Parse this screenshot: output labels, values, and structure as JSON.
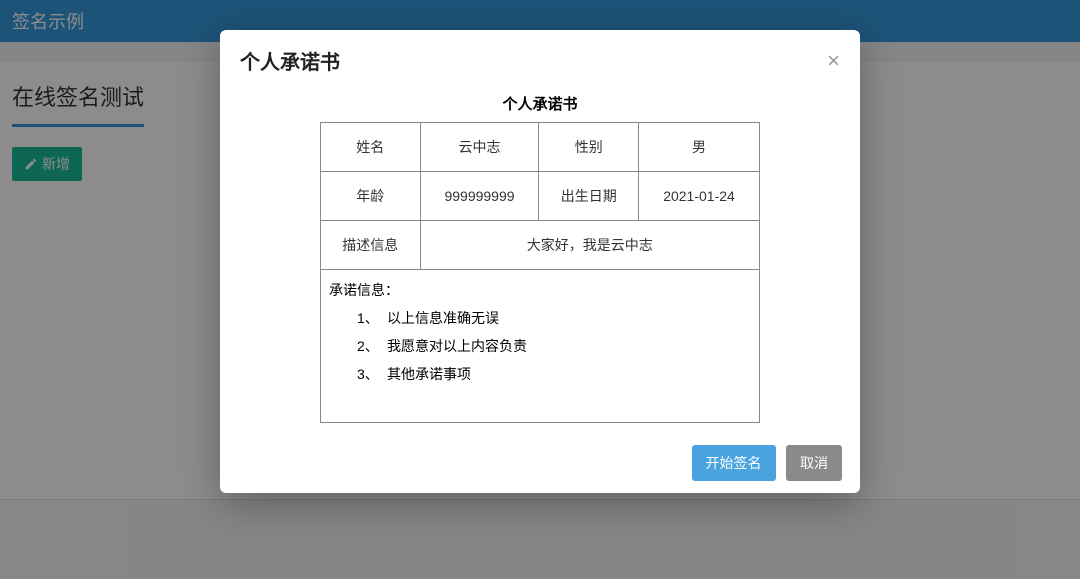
{
  "header": {
    "title": "签名示例"
  },
  "page": {
    "section_title": "在线签名测试",
    "add_button_label": "新增"
  },
  "modal": {
    "title": "个人承诺书",
    "close_glyph": "×",
    "document": {
      "heading": "个人承诺书",
      "fields": {
        "name_label": "姓名",
        "name_value": "云中志",
        "gender_label": "性别",
        "gender_value": "男",
        "age_label": "年龄",
        "age_value": "999999999",
        "dob_label": "出生日期",
        "dob_value": "2021-01-24",
        "desc_label": "描述信息",
        "desc_value": "大家好，我是云中志"
      },
      "commitment": {
        "title": "承诺信息：",
        "items": [
          "以上信息准确无误",
          "我愿意对以上内容负责",
          "其他承诺事项"
        ]
      }
    },
    "footer": {
      "start_sign_label": "开始签名",
      "cancel_label": "取消"
    }
  }
}
